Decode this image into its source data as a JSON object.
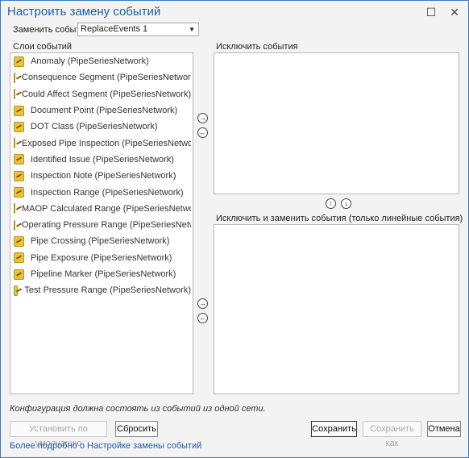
{
  "window": {
    "title": "Настроить замену событий",
    "min_glyph": "—",
    "max_glyph": "☐",
    "close_glyph": "✕"
  },
  "replace_events": {
    "label": "Заменить события",
    "selected": "ReplaceEvents 1"
  },
  "layers": {
    "label": "Слои событий",
    "items": [
      "Anomaly (PipeSeriesNetwork)",
      "Consequence Segment (PipeSeriesNetwork)",
      "Could Affect Segment (PipeSeriesNetwork)",
      "Document Point (PipeSeriesNetwork)",
      "DOT Class (PipeSeriesNetwork)",
      "Exposed Pipe Inspection (PipeSeriesNetwork)",
      "Identified Issue (PipeSeriesNetwork)",
      "Inspection Note (PipeSeriesNetwork)",
      "Inspection Range (PipeSeriesNetwork)",
      "MAOP Calculated Range (PipeSeriesNetwork)",
      "Operating Pressure Range (PipeSeriesNetwork)",
      "Pipe Crossing (PipeSeriesNetwork)",
      "Pipe Exposure (PipeSeriesNetwork)",
      "Pipeline Marker (PipeSeriesNetwork)",
      "Test Pressure Range (PipeSeriesNetwork)"
    ]
  },
  "exclude": {
    "label": "Исключить события"
  },
  "exclude_replace": {
    "label": "Исключить и заменить события (только линейные события)"
  },
  "arrows": {
    "right": "→",
    "left": "←",
    "up": "↑",
    "down": "↓"
  },
  "note": "Конфигурация должна состоять из событий из одной сети.",
  "buttons": {
    "set_default": "Установить по умолчанию",
    "reset": "Сбросить",
    "save": "Сохранить",
    "save_as": "Сохранить как",
    "cancel": "Отмена"
  },
  "help_link": "Более подробно о Настройке замены событий"
}
